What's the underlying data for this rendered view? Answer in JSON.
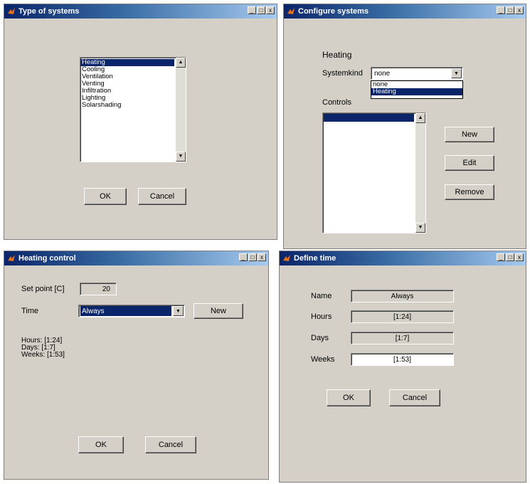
{
  "win1": {
    "title": "Type of systems",
    "list": [
      "Heating",
      "Cooling",
      "Ventilation",
      "Venting",
      "Infiltration",
      "Lighting",
      "Solarshading"
    ],
    "selected_index": 0,
    "ok_label": "OK",
    "cancel_label": "Cancel"
  },
  "win2": {
    "title": "Configure systems",
    "heading": "Heating",
    "systemkind_label": "Systemkind",
    "systemkind_value": "none",
    "dropdown_options": [
      "none",
      "Heating"
    ],
    "controls_label": "Controls",
    "new_label": "New",
    "edit_label": "Edit",
    "remove_label": "Remove"
  },
  "win3": {
    "title": "Heating control",
    "setpoint_label": "Set point [C]",
    "setpoint_value": "20",
    "time_label": "Time",
    "time_value": "Always",
    "new_label": "New",
    "info_hours": "Hours: [1:24]",
    "info_days": "Days: [1:7]",
    "info_weeks": "Weeks: [1:53]",
    "ok_label": "OK",
    "cancel_label": "Cancel"
  },
  "win4": {
    "title": "Define time",
    "name_label": "Name",
    "name_value": "Always",
    "hours_label": "Hours",
    "hours_value": "[1:24]",
    "days_label": "Days",
    "days_value": "[1:7]",
    "weeks_label": "Weeks",
    "weeks_value": "[1:53]",
    "ok_label": "OK",
    "cancel_label": "Cancel"
  },
  "titlebar_buttons": {
    "min": "_",
    "max": "□",
    "close": "x"
  },
  "colors": {
    "titlebar": "#0a246a",
    "face": "#d4d0c8",
    "selection": "#0a246a"
  }
}
